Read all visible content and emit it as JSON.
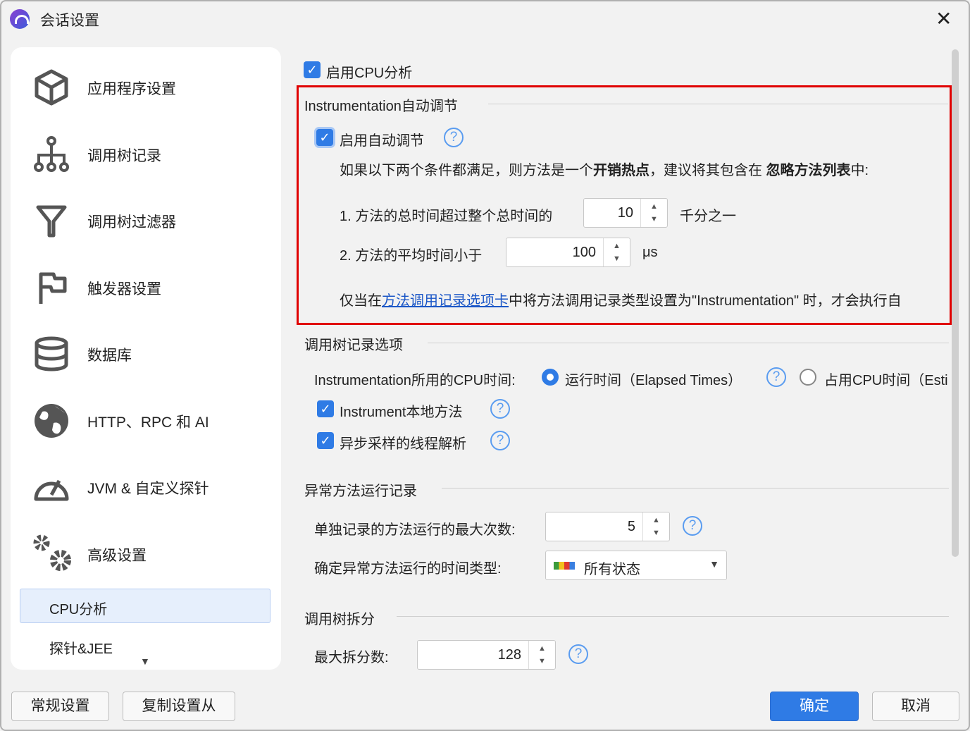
{
  "window": {
    "title": "会话设置"
  },
  "sidebar": {
    "items": [
      {
        "label": "应用程序设置",
        "icon": "cube-icon"
      },
      {
        "label": "调用树记录",
        "icon": "tree-icon"
      },
      {
        "label": "调用树过滤器",
        "icon": "filter-icon"
      },
      {
        "label": "触发器设置",
        "icon": "flag-icon"
      },
      {
        "label": "数据库",
        "icon": "database-icon"
      },
      {
        "label": "HTTP、RPC 和 AI",
        "icon": "globe-icon"
      },
      {
        "label": "JVM & 自定义探针",
        "icon": "gauge-icon"
      },
      {
        "label": "高级设置",
        "icon": "gears-icon"
      }
    ],
    "subitems": [
      {
        "label": "CPU分析",
        "selected": true
      },
      {
        "label": "探针&JEE"
      }
    ]
  },
  "main": {
    "enable_cpu": "启用CPU分析",
    "auto": {
      "heading": "Instrumentation自动调节",
      "enable": "启用自动调节",
      "desc_pre": "如果以下两个条件都满足，则方法是一个",
      "desc_bold1": "开销热点",
      "desc_mid": "，建议将其包含在 ",
      "desc_bold2": "忽略方法列表",
      "desc_post": "中:",
      "cond1": "1. 方法的总时间超过整个总时间的",
      "cond1_value": "10",
      "cond1_unit": "千分之一",
      "cond2": "2. 方法的平均时间小于",
      "cond2_value": "100",
      "cond2_unit": "μs",
      "note_pre": "仅当在",
      "note_link": "方法调用记录选项卡",
      "note_post": "中将方法调用记录类型设置为\"Instrumentation\" 时，才会执行自"
    },
    "tree": {
      "heading": "调用树记录选项",
      "cpu_time_label": "Instrumentation所用的CPU时间:",
      "radio1": "运行时间（Elapsed Times）",
      "radio2": "占用CPU时间（Esti",
      "native": "Instrument本地方法",
      "async": "异步采样的线程解析"
    },
    "exc": {
      "heading": "异常方法运行记录",
      "max_label": "单独记录的方法运行的最大次数:",
      "max_value": "5",
      "type_label": "确定异常方法运行的时间类型:",
      "type_value": "所有状态"
    },
    "split": {
      "heading": "调用树拆分",
      "max_label": "最大拆分数:",
      "max_value": "128"
    }
  },
  "footer": {
    "general": "常规设置",
    "copy": "复制设置从",
    "ok": "确定",
    "cancel": "取消"
  }
}
